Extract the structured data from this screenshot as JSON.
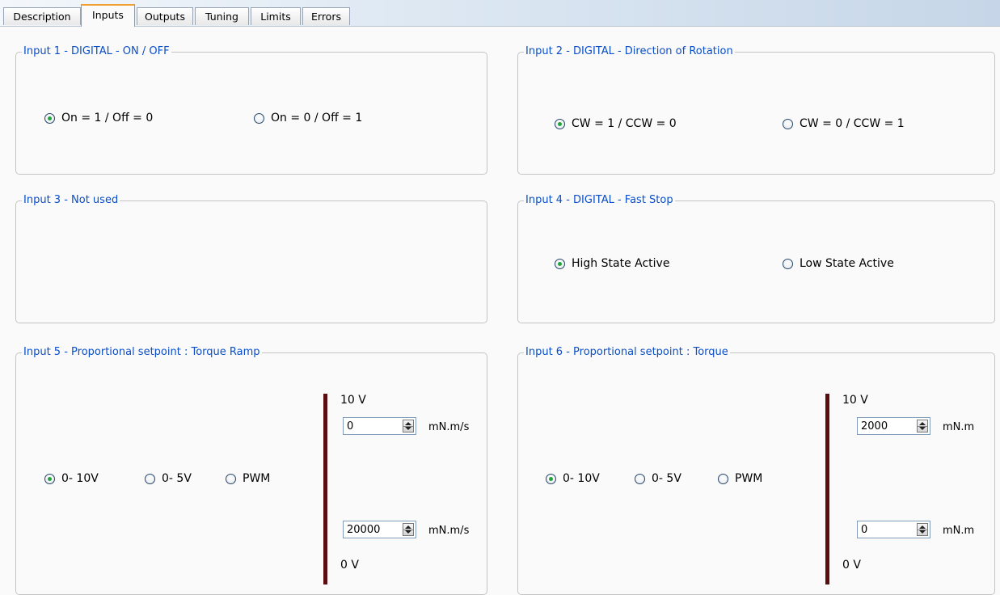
{
  "tabs": [
    "Description",
    "Inputs",
    "Outputs",
    "Tuning",
    "Limits",
    "Errors"
  ],
  "active_tab": "Inputs",
  "colors": {
    "legend": "#0a4ec8",
    "bar": "#5a0c10",
    "radio_checked": "#22a43c",
    "active_tab_accent": "#f0a030"
  },
  "input1": {
    "title": "Input 1 - DIGITAL - ON / OFF",
    "opt1": "On = 1 / Off = 0",
    "opt2": "On = 0 / Off = 1",
    "selected": 1
  },
  "input2": {
    "title": "Input 2 - DIGITAL - Direction of Rotation",
    "opt1": "CW = 1 / CCW = 0",
    "opt2": "CW = 0 / CCW = 1",
    "selected": 1
  },
  "input3": {
    "title": "Input 3 - Not used"
  },
  "input4": {
    "title": "Input 4 - DIGITAL - Fast Stop",
    "opt1": "High State Active",
    "opt2": "Low State Active",
    "selected": 1
  },
  "input5": {
    "title": "Input 5 - Proportional setpoint : Torque Ramp",
    "opt1": "0- 10V",
    "opt2": "0- 5V",
    "opt3": "PWM",
    "selected": 1,
    "top_label": "10 V",
    "bottom_label": "0 V",
    "top_value": "0",
    "bottom_value": "20000",
    "top_unit": "mN.m/s",
    "bottom_unit": "mN.m/s"
  },
  "input6": {
    "title": "Input 6 - Proportional setpoint : Torque",
    "opt1": "0- 10V",
    "opt2": "0- 5V",
    "opt3": "PWM",
    "selected": 1,
    "top_label": "10 V",
    "bottom_label": "0 V",
    "top_value": "2000",
    "bottom_value": "0",
    "top_unit": "mN.m",
    "bottom_unit": "mN.m"
  }
}
